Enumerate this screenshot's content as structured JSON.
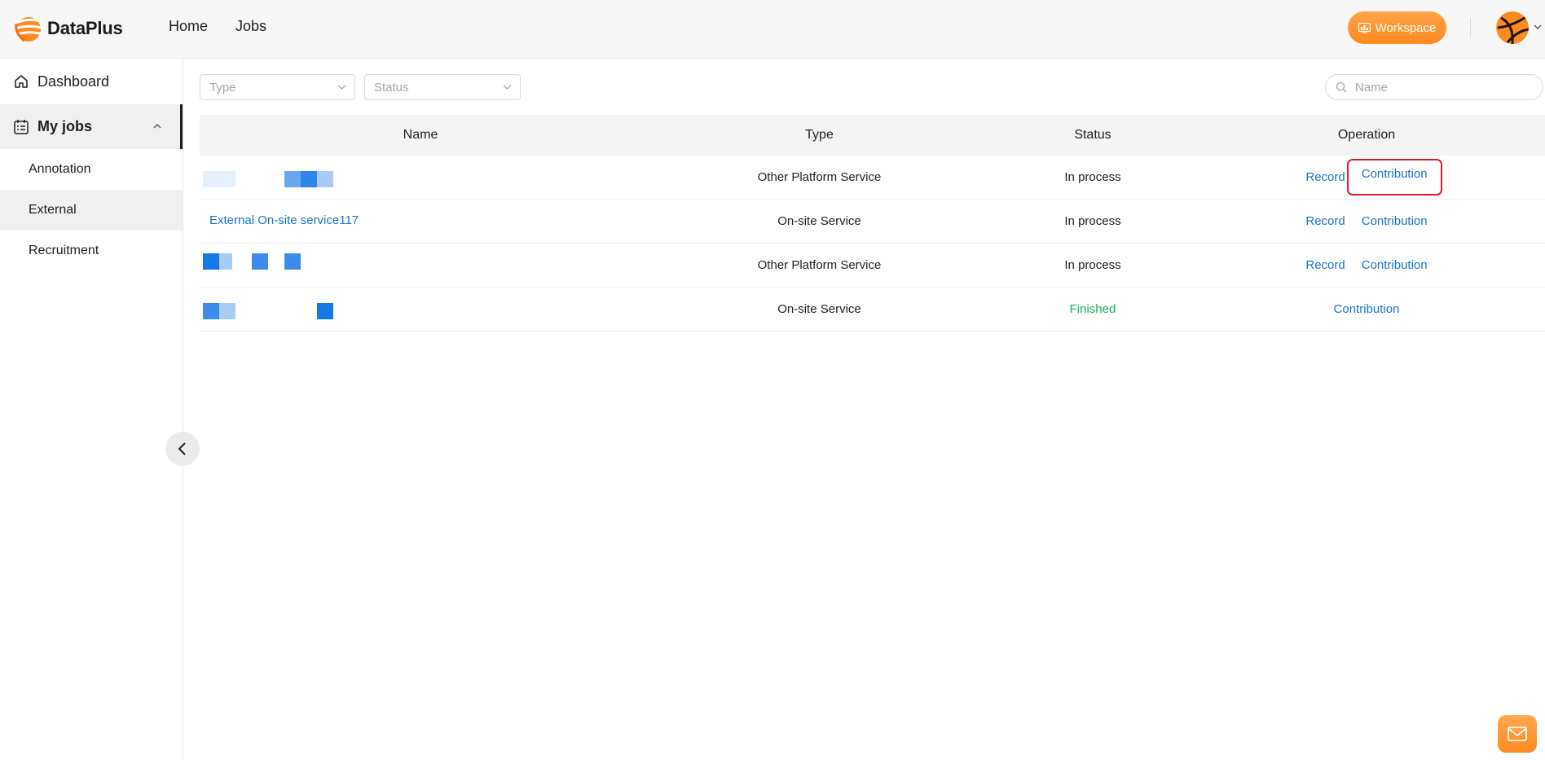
{
  "app": {
    "brand": "DataPlus",
    "colors": {
      "accent": "#ff8a1f",
      "link": "#1a73c8",
      "success": "#16b35a",
      "highlight": "#e6192b"
    }
  },
  "header": {
    "nav": [
      {
        "label": "Home"
      },
      {
        "label": "Jobs"
      }
    ],
    "workspace_label": "Workspace",
    "icons": {
      "workspace": "chart-board-icon",
      "avatar": "user-avatar",
      "caret": "chevron-down-icon"
    }
  },
  "sidebar": {
    "dashboard": "Dashboard",
    "my_jobs": "My jobs",
    "sub_items": [
      {
        "label": "Annotation"
      },
      {
        "label": "External"
      },
      {
        "label": "Recruitment"
      }
    ],
    "selected": "External"
  },
  "filters": {
    "type_placeholder": "Type",
    "status_placeholder": "Status",
    "search_placeholder": "Name"
  },
  "table": {
    "columns": [
      "Name",
      "Type",
      "Status",
      "Operation"
    ],
    "rows": [
      {
        "name": "",
        "type": "Other Platform Service",
        "status": "In process",
        "ops": [
          "Record",
          "Contribution"
        ]
      },
      {
        "name": "External On-site service117",
        "type": "On-site Service",
        "status": "In process",
        "ops": [
          "Record",
          "Contribution"
        ]
      },
      {
        "name": "",
        "type": "Other Platform Service",
        "status": "In process",
        "ops": [
          "Record",
          "Contribution"
        ]
      },
      {
        "name": "",
        "type": "On-site Service",
        "status": "Finished",
        "ops": [
          "Contribution"
        ]
      }
    ]
  }
}
